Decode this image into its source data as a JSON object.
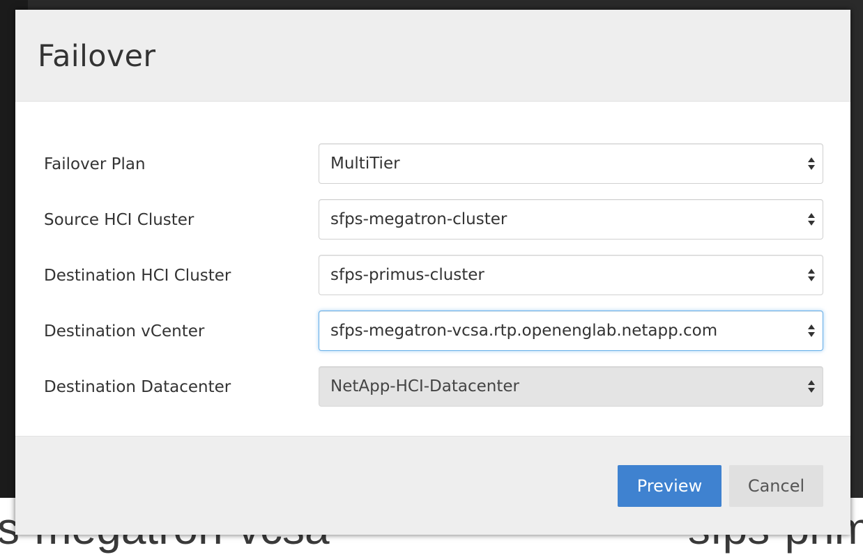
{
  "background": {
    "text_left": "s-megatron-vcsa",
    "text_right": "sfps-prim"
  },
  "dialog": {
    "title": "Failover",
    "fields": [
      {
        "label": "Failover Plan",
        "value": "MultiTier",
        "state": "normal",
        "icon": "select-caret-icon"
      },
      {
        "label": "Source HCI Cluster",
        "value": "sfps-megatron-cluster",
        "state": "normal",
        "icon": "select-caret-icon"
      },
      {
        "label": "Destination HCI Cluster",
        "value": "sfps-primus-cluster",
        "state": "normal",
        "icon": "select-caret-icon"
      },
      {
        "label": "Destination vCenter",
        "value": "sfps-megatron-vcsa.rtp.openenglab.netapp.com",
        "state": "focused",
        "icon": "select-caret-icon"
      },
      {
        "label": "Destination Datacenter",
        "value": "NetApp-HCI-Datacenter",
        "state": "disabled",
        "icon": "select-caret-icon"
      }
    ],
    "buttons": {
      "preview_label": "Preview",
      "cancel_label": "Cancel"
    }
  },
  "colors": {
    "primary_button": "#3f82d0",
    "focus_border": "#66afe9",
    "header_bg": "#eeeeee"
  }
}
